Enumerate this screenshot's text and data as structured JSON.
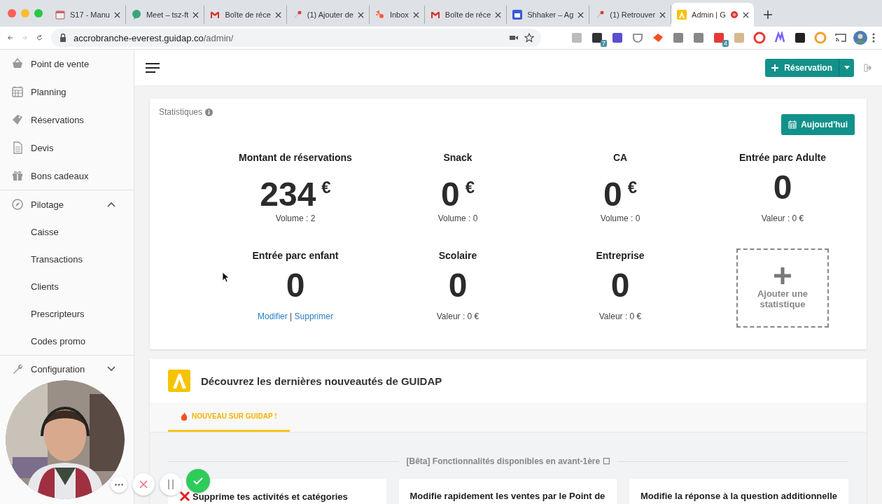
{
  "browser": {
    "tabs": [
      {
        "title": "S17 - Manu",
        "kind": "calendar",
        "selected": false
      },
      {
        "title": "Meet – tsz-ft",
        "kind": "meet",
        "selected": false
      },
      {
        "title": "Boîte de réce",
        "kind": "mail",
        "selected": false
      },
      {
        "title": "(1) Ajouter de",
        "kind": "pin",
        "selected": false
      },
      {
        "title": "Inbox",
        "kind": "hub",
        "selected": false
      },
      {
        "title": "Boîte de réce",
        "kind": "mail",
        "selected": false
      },
      {
        "title": "Shhaker – Ag",
        "kind": "calendar-blue",
        "selected": false
      },
      {
        "title": "(1) Retrouver",
        "kind": "pin",
        "selected": false
      },
      {
        "title": "Admin | G",
        "kind": "logo",
        "selected": true,
        "recording": true
      }
    ],
    "url_host": "accrobranche-everest.guidap.co",
    "url_path": "/admin/",
    "extensions": [
      {
        "kind": "chat"
      },
      {
        "kind": "chart",
        "badge": "7"
      },
      {
        "kind": "dropper"
      },
      {
        "kind": "pocket"
      },
      {
        "kind": "bird"
      },
      {
        "kind": "hub"
      },
      {
        "kind": "facebook"
      },
      {
        "kind": "dots",
        "badge": "4"
      },
      {
        "kind": "box"
      },
      {
        "kind": "ring"
      },
      {
        "kind": "m"
      },
      {
        "kind": "contacts"
      },
      {
        "kind": "globe"
      }
    ]
  },
  "sidebar": {
    "sections": [
      {
        "items": [
          {
            "label": "Point de vente",
            "kind": "basket"
          },
          {
            "label": "Planning",
            "kind": "calendar"
          },
          {
            "label": "Réservations",
            "kind": "ticket"
          },
          {
            "label": "Devis",
            "kind": "document"
          },
          {
            "label": "Bons cadeaux",
            "kind": "gift"
          }
        ]
      },
      {
        "items": [
          {
            "label": "Pilotage",
            "kind": "compass",
            "expanded": true,
            "children": [
              {
                "label": "Caisse"
              },
              {
                "label": "Transactions"
              },
              {
                "label": "Clients"
              },
              {
                "label": "Prescripteurs"
              },
              {
                "label": "Codes promo"
              }
            ]
          }
        ]
      },
      {
        "items": [
          {
            "label": "Configuration",
            "kind": "wrench",
            "expanded": false
          }
        ]
      }
    ]
  },
  "header": {
    "reservation_button": "Réservation"
  },
  "stats": {
    "title": "Statistiques",
    "today_button": "Aujourd'hui",
    "tiles": [
      {
        "kind": "stat",
        "title": "Montant de réservations",
        "value": "234",
        "currency": "€",
        "footer": "Volume : 2"
      },
      {
        "kind": "stat",
        "title": "Snack",
        "value": "0",
        "currency": "€",
        "footer": "Volume : 0"
      },
      {
        "kind": "stat",
        "title": "CA",
        "value": "0",
        "currency": "€",
        "footer": "Volume : 0"
      },
      {
        "kind": "stat",
        "title": "Entrée parc Adulte",
        "value": "0",
        "footer": "Valeur : 0 €"
      },
      {
        "kind": "stat",
        "title": "Entrée parc enfant",
        "value": "0",
        "links": [
          "Modifier",
          "Supprimer"
        ],
        "link_separator": "|"
      },
      {
        "kind": "stat",
        "title": "Scolaire",
        "value": "0",
        "footer": "Valeur : 0 €"
      },
      {
        "kind": "stat",
        "title": "Entreprise",
        "value": "0",
        "footer": "Valeur : 0 €"
      },
      {
        "kind": "add",
        "label": "Ajouter une statistique"
      }
    ]
  },
  "news": {
    "title": "Découvrez les dernières nouveautés de GUIDAP",
    "tabs": [
      {
        "label": "NOUVEAU SUR GUIDAP !",
        "selected": true
      }
    ],
    "section_title": "[Bêta] Fonctionnalités disponibles en avant-1ère ☐",
    "cards": [
      {
        "title": "Supprime tes activités et catégories",
        "kind": "removed"
      },
      {
        "title": "Modifie rapidement les ventes par le Point de",
        "kind": "plain"
      },
      {
        "title": "Modifie la réponse à la question additionnelle",
        "kind": "plain"
      }
    ]
  }
}
